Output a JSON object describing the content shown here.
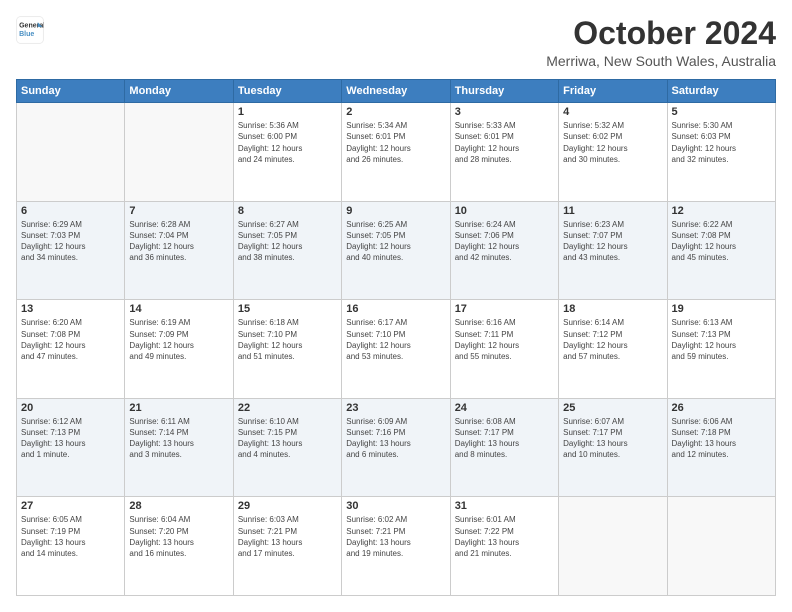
{
  "logo": {
    "line1": "General",
    "line2": "Blue"
  },
  "title": "October 2024",
  "subtitle": "Merriwa, New South Wales, Australia",
  "days_header": [
    "Sunday",
    "Monday",
    "Tuesday",
    "Wednesday",
    "Thursday",
    "Friday",
    "Saturday"
  ],
  "weeks": [
    [
      {
        "day": "",
        "info": ""
      },
      {
        "day": "",
        "info": ""
      },
      {
        "day": "1",
        "info": "Sunrise: 5:36 AM\nSunset: 6:00 PM\nDaylight: 12 hours\nand 24 minutes."
      },
      {
        "day": "2",
        "info": "Sunrise: 5:34 AM\nSunset: 6:01 PM\nDaylight: 12 hours\nand 26 minutes."
      },
      {
        "day": "3",
        "info": "Sunrise: 5:33 AM\nSunset: 6:01 PM\nDaylight: 12 hours\nand 28 minutes."
      },
      {
        "day": "4",
        "info": "Sunrise: 5:32 AM\nSunset: 6:02 PM\nDaylight: 12 hours\nand 30 minutes."
      },
      {
        "day": "5",
        "info": "Sunrise: 5:30 AM\nSunset: 6:03 PM\nDaylight: 12 hours\nand 32 minutes."
      }
    ],
    [
      {
        "day": "6",
        "info": "Sunrise: 6:29 AM\nSunset: 7:03 PM\nDaylight: 12 hours\nand 34 minutes."
      },
      {
        "day": "7",
        "info": "Sunrise: 6:28 AM\nSunset: 7:04 PM\nDaylight: 12 hours\nand 36 minutes."
      },
      {
        "day": "8",
        "info": "Sunrise: 6:27 AM\nSunset: 7:05 PM\nDaylight: 12 hours\nand 38 minutes."
      },
      {
        "day": "9",
        "info": "Sunrise: 6:25 AM\nSunset: 7:05 PM\nDaylight: 12 hours\nand 40 minutes."
      },
      {
        "day": "10",
        "info": "Sunrise: 6:24 AM\nSunset: 7:06 PM\nDaylight: 12 hours\nand 42 minutes."
      },
      {
        "day": "11",
        "info": "Sunrise: 6:23 AM\nSunset: 7:07 PM\nDaylight: 12 hours\nand 43 minutes."
      },
      {
        "day": "12",
        "info": "Sunrise: 6:22 AM\nSunset: 7:08 PM\nDaylight: 12 hours\nand 45 minutes."
      }
    ],
    [
      {
        "day": "13",
        "info": "Sunrise: 6:20 AM\nSunset: 7:08 PM\nDaylight: 12 hours\nand 47 minutes."
      },
      {
        "day": "14",
        "info": "Sunrise: 6:19 AM\nSunset: 7:09 PM\nDaylight: 12 hours\nand 49 minutes."
      },
      {
        "day": "15",
        "info": "Sunrise: 6:18 AM\nSunset: 7:10 PM\nDaylight: 12 hours\nand 51 minutes."
      },
      {
        "day": "16",
        "info": "Sunrise: 6:17 AM\nSunset: 7:10 PM\nDaylight: 12 hours\nand 53 minutes."
      },
      {
        "day": "17",
        "info": "Sunrise: 6:16 AM\nSunset: 7:11 PM\nDaylight: 12 hours\nand 55 minutes."
      },
      {
        "day": "18",
        "info": "Sunrise: 6:14 AM\nSunset: 7:12 PM\nDaylight: 12 hours\nand 57 minutes."
      },
      {
        "day": "19",
        "info": "Sunrise: 6:13 AM\nSunset: 7:13 PM\nDaylight: 12 hours\nand 59 minutes."
      }
    ],
    [
      {
        "day": "20",
        "info": "Sunrise: 6:12 AM\nSunset: 7:13 PM\nDaylight: 13 hours\nand 1 minute."
      },
      {
        "day": "21",
        "info": "Sunrise: 6:11 AM\nSunset: 7:14 PM\nDaylight: 13 hours\nand 3 minutes."
      },
      {
        "day": "22",
        "info": "Sunrise: 6:10 AM\nSunset: 7:15 PM\nDaylight: 13 hours\nand 4 minutes."
      },
      {
        "day": "23",
        "info": "Sunrise: 6:09 AM\nSunset: 7:16 PM\nDaylight: 13 hours\nand 6 minutes."
      },
      {
        "day": "24",
        "info": "Sunrise: 6:08 AM\nSunset: 7:17 PM\nDaylight: 13 hours\nand 8 minutes."
      },
      {
        "day": "25",
        "info": "Sunrise: 6:07 AM\nSunset: 7:17 PM\nDaylight: 13 hours\nand 10 minutes."
      },
      {
        "day": "26",
        "info": "Sunrise: 6:06 AM\nSunset: 7:18 PM\nDaylight: 13 hours\nand 12 minutes."
      }
    ],
    [
      {
        "day": "27",
        "info": "Sunrise: 6:05 AM\nSunset: 7:19 PM\nDaylight: 13 hours\nand 14 minutes."
      },
      {
        "day": "28",
        "info": "Sunrise: 6:04 AM\nSunset: 7:20 PM\nDaylight: 13 hours\nand 16 minutes."
      },
      {
        "day": "29",
        "info": "Sunrise: 6:03 AM\nSunset: 7:21 PM\nDaylight: 13 hours\nand 17 minutes."
      },
      {
        "day": "30",
        "info": "Sunrise: 6:02 AM\nSunset: 7:21 PM\nDaylight: 13 hours\nand 19 minutes."
      },
      {
        "day": "31",
        "info": "Sunrise: 6:01 AM\nSunset: 7:22 PM\nDaylight: 13 hours\nand 21 minutes."
      },
      {
        "day": "",
        "info": ""
      },
      {
        "day": "",
        "info": ""
      }
    ]
  ]
}
